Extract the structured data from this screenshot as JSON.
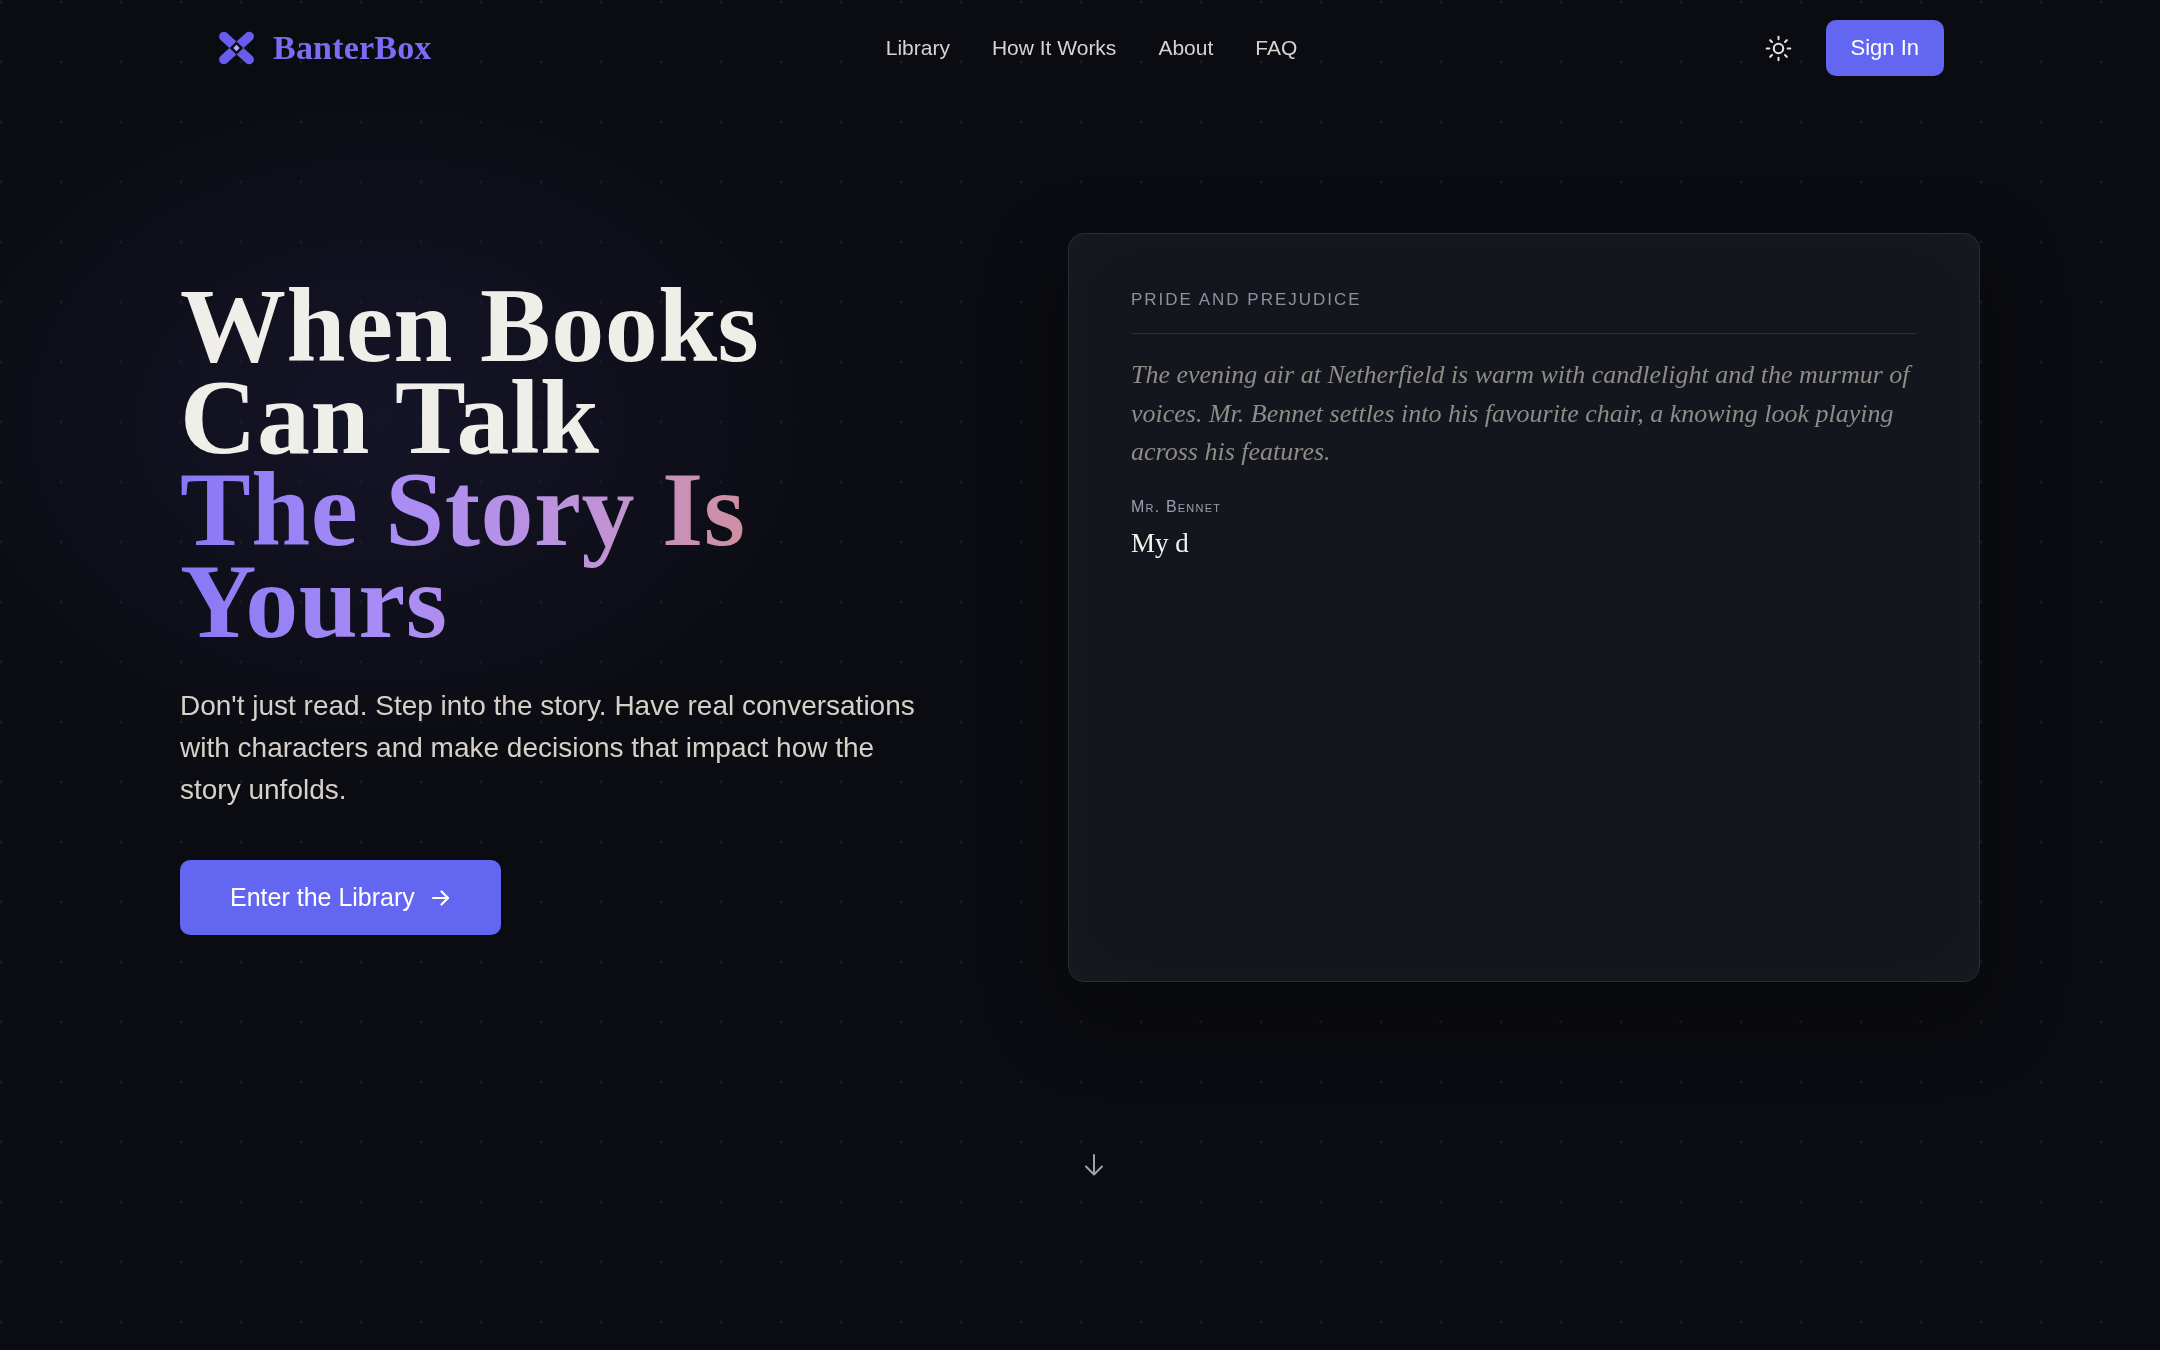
{
  "header": {
    "logo": "BanterBox",
    "nav": [
      {
        "label": "Library"
      },
      {
        "label": "How It Works"
      },
      {
        "label": "About"
      },
      {
        "label": "FAQ"
      }
    ],
    "sign_in": "Sign In"
  },
  "hero": {
    "heading": {
      "text": "When Books Can Talk",
      "highlight": "The Story Is Yours"
    },
    "subtitle": "Don't just read. Step into the story. Have real conversations with characters and make decisions that impact how the story unfolds.",
    "cta": "Enter the Library"
  },
  "story_card": {
    "book_title": "PRIDE AND PREJUDICE",
    "narration": "The evening air at Netherfield is warm with candlelight and the murmur of voices. Mr. Bennet settles into his favourite chair, a knowing look playing across his features.",
    "speaker": "Mr. Bennet",
    "dialogue": "My d"
  }
}
